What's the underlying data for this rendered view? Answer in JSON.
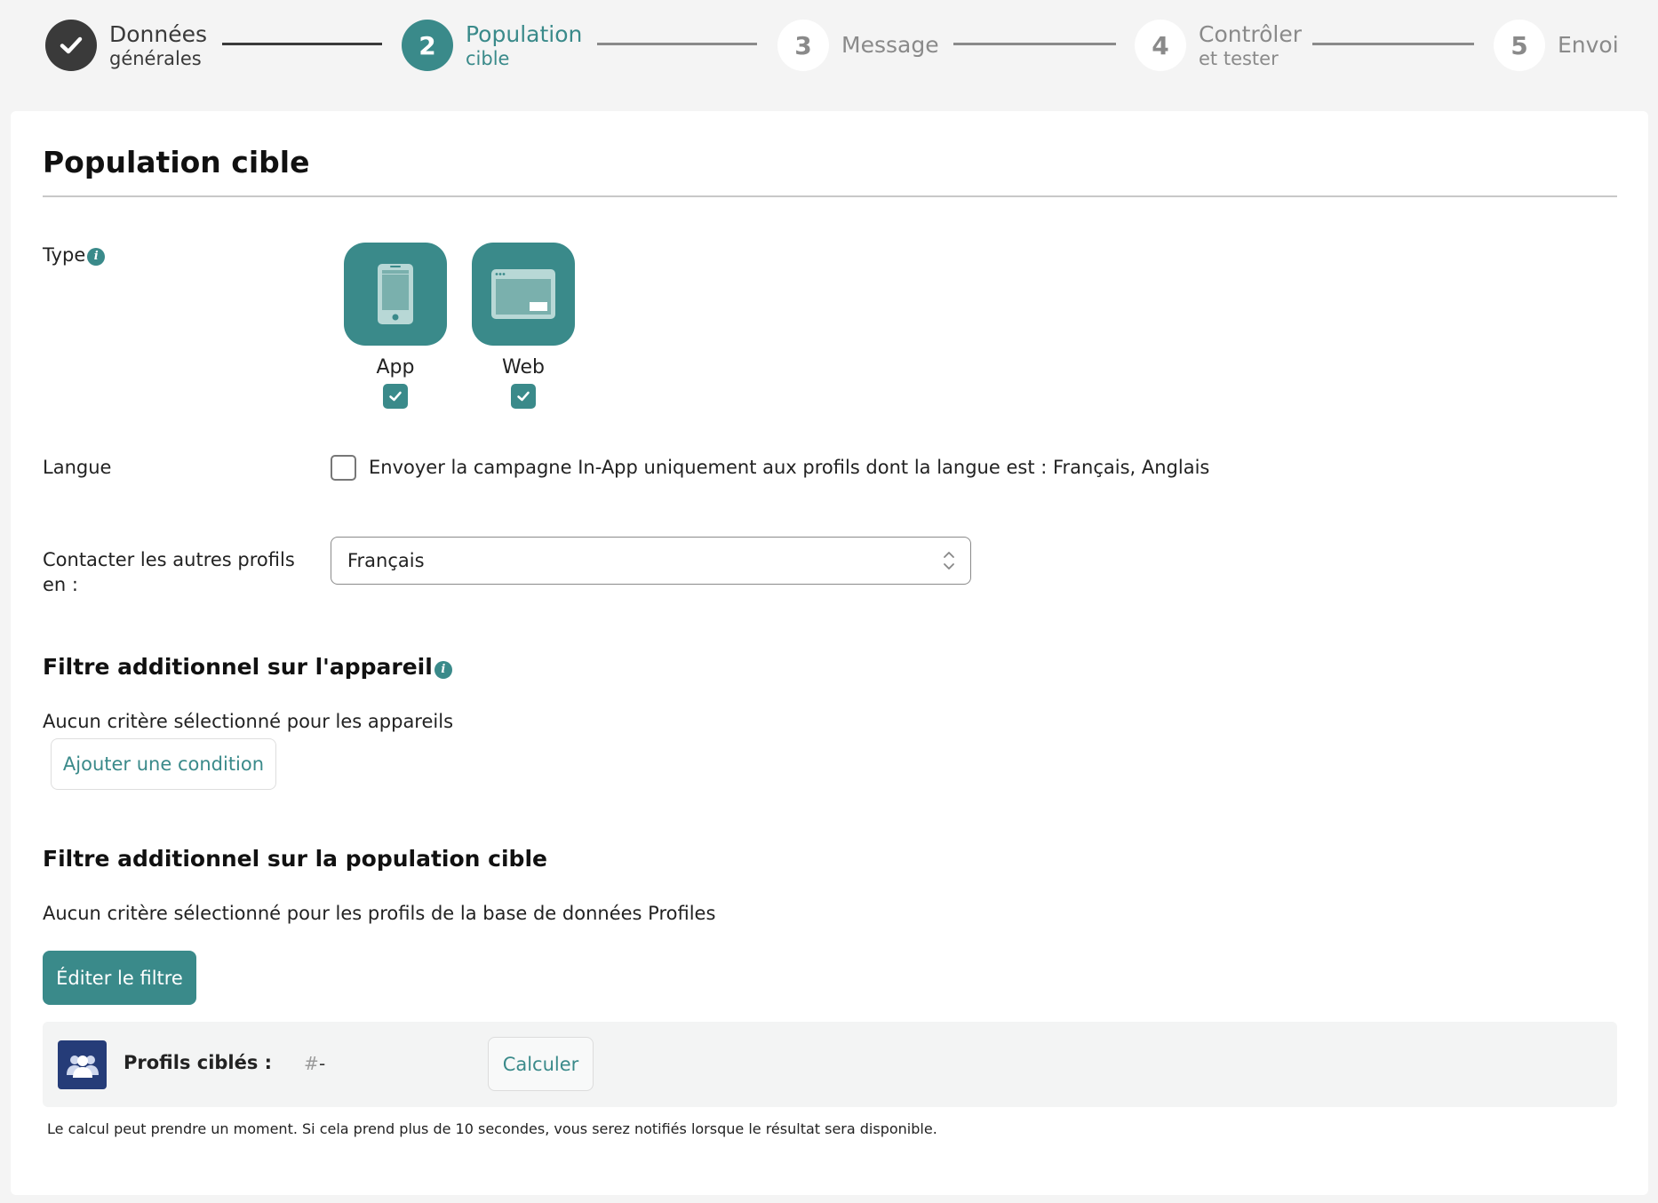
{
  "stepper": {
    "steps": [
      {
        "number": "",
        "label": "Données",
        "sub": "générales",
        "state": "done"
      },
      {
        "number": "2",
        "label": "Population",
        "sub": "cible",
        "state": "active"
      },
      {
        "number": "3",
        "label": "Message",
        "sub": "",
        "state": "todo"
      },
      {
        "number": "4",
        "label": "Contrôler",
        "sub": "et tester",
        "state": "todo"
      },
      {
        "number": "5",
        "label": "Envoi",
        "sub": "",
        "state": "todo"
      }
    ]
  },
  "page": {
    "title": "Population cible"
  },
  "type_row": {
    "label": "Type",
    "options": [
      {
        "label": "App",
        "checked": true
      },
      {
        "label": "Web",
        "checked": true
      }
    ]
  },
  "langue_row": {
    "label": "Langue",
    "checkbox_text": "Envoyer la campagne In-App uniquement aux profils dont la langue est : Français, Anglais",
    "checked": false
  },
  "contact_row": {
    "label_line1": "Contacter les autres profils",
    "label_line2": "en :",
    "selected_value": "Français"
  },
  "device_filter": {
    "title": "Filtre additionnel sur l'appareil",
    "empty_text": "Aucun critère sélectionné pour les appareils",
    "add_button": "Ajouter une condition"
  },
  "population_filter": {
    "title": "Filtre additionnel sur la population cible",
    "empty_text": "Aucun critère sélectionné pour les profils de la base de données Profiles",
    "edit_button": "Éditer le filtre"
  },
  "profiles": {
    "label": "Profils ciblés :",
    "hash": "#",
    "count": "-",
    "calc_button": "Calculer",
    "footnote": "Le calcul peut prendre un moment. Si cela prend plus de 10 secondes, vous serez notifiés lorsque le résultat sera disponible."
  },
  "colors": {
    "accent": "#3a8a8a",
    "done": "#3a3a3a",
    "todo": "#8a8a8a",
    "profiles_icon_bg": "#253c78"
  }
}
